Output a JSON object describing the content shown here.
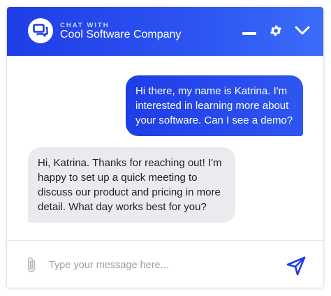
{
  "header": {
    "kicker": "CHAT WITH",
    "title": "Cool Software Company",
    "logo_icon": "chat-bubbles-icon",
    "actions": [
      "minimize-icon",
      "gear-icon",
      "chevron-down-icon"
    ]
  },
  "messages": [
    {
      "direction": "outgoing",
      "text": "Hi there, my name is Katrina. I'm interested in learning more about your software. Can I see a demo?"
    },
    {
      "direction": "incoming",
      "text": "Hi, Katrina. Thanks for reaching out! I'm happy to set up a quick meeting to discuss our product and pricing in more detail. What day works best for you?"
    }
  ],
  "composer": {
    "placeholder": "Type your message here...",
    "value": "",
    "attach_icon": "paperclip-icon",
    "send_icon": "send-icon"
  },
  "colors": {
    "header_start": "#1f3de6",
    "header_end": "#3a6cf8",
    "outgoing_bubble": "#2448ec",
    "incoming_bubble": "#e9ebef",
    "send_icon": "#1f3de6"
  }
}
